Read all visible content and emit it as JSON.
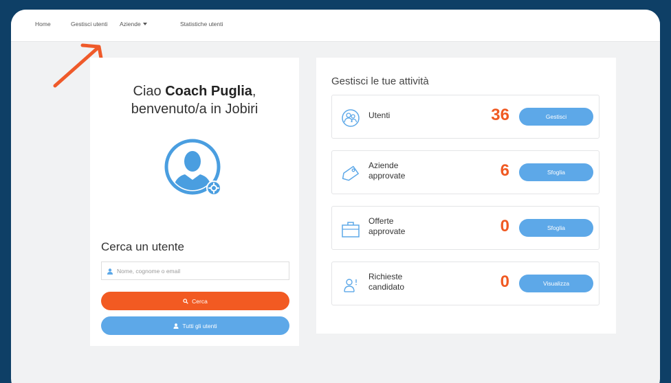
{
  "nav": {
    "home": "Home",
    "gestisci_utenti": "Gestisci utenti",
    "aziende": "Aziende",
    "statistiche": "Statistiche utenti"
  },
  "welcome": {
    "hello": "Ciao",
    "name": "Coach Puglia",
    "punct": ",",
    "line2": "benvenuto/a in Jobiri"
  },
  "search": {
    "title": "Cerca un utente",
    "placeholder": "Nome, cognome o email",
    "search_button": "Cerca",
    "all_users_button": "Tutti gli utenti"
  },
  "activities": {
    "title": "Gestisci le tue attività",
    "items": [
      {
        "label": "Utenti",
        "count": "36",
        "button": "Gestisci",
        "icon": "users-icon"
      },
      {
        "label": "Aziende approvate",
        "count": "6",
        "button": "Sfoglia",
        "icon": "tag-icon"
      },
      {
        "label": "Offerte approvate",
        "count": "0",
        "button": "Sfoglia",
        "icon": "briefcase-icon"
      },
      {
        "label": "Richieste candidato",
        "count": "0",
        "button": "Visualizza",
        "icon": "candidate-request-icon"
      }
    ]
  },
  "colors": {
    "background": "#0e3f66",
    "accent_orange": "#f25a22",
    "accent_blue": "#5da8e8"
  }
}
